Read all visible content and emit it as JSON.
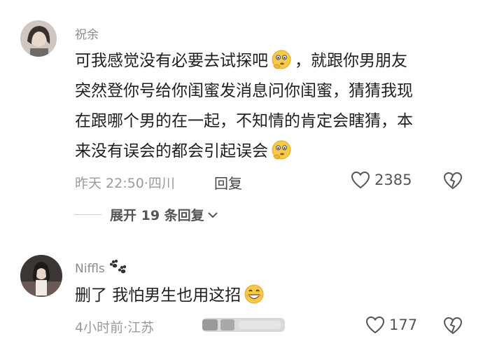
{
  "comments": [
    {
      "username": "祝余",
      "text": {
        "seg1": "可我感觉没有必要去试探吧",
        "seg2": "，就跟你男朋友",
        "line2": "突然登你号给你闺蜜发消息问你闺蜜，猜猜我现",
        "line3": "在跟哪个男的在一起，不知情的肯定会瞎猜，本",
        "line4": "来没有误会的都会引起误会"
      },
      "emoji": "thinking-face-emoji",
      "time": "昨天 22:50",
      "location": "四川",
      "separator": "·",
      "reply_label": "回复",
      "likes": "2385",
      "expand_label": "展开 19 条回复"
    },
    {
      "username": "Niffls",
      "username_badge": "paw-prints-icon",
      "text": {
        "seg1": "删了 我怕男生也用这招"
      },
      "emoji": "grinning-face-emoji",
      "time": "4小时前",
      "location": "江苏",
      "separator": "·",
      "likes": "177"
    }
  ],
  "colors": {
    "meta": "#9a9a9a",
    "username": "#8a8a8a",
    "body": "#1f1f1f"
  }
}
